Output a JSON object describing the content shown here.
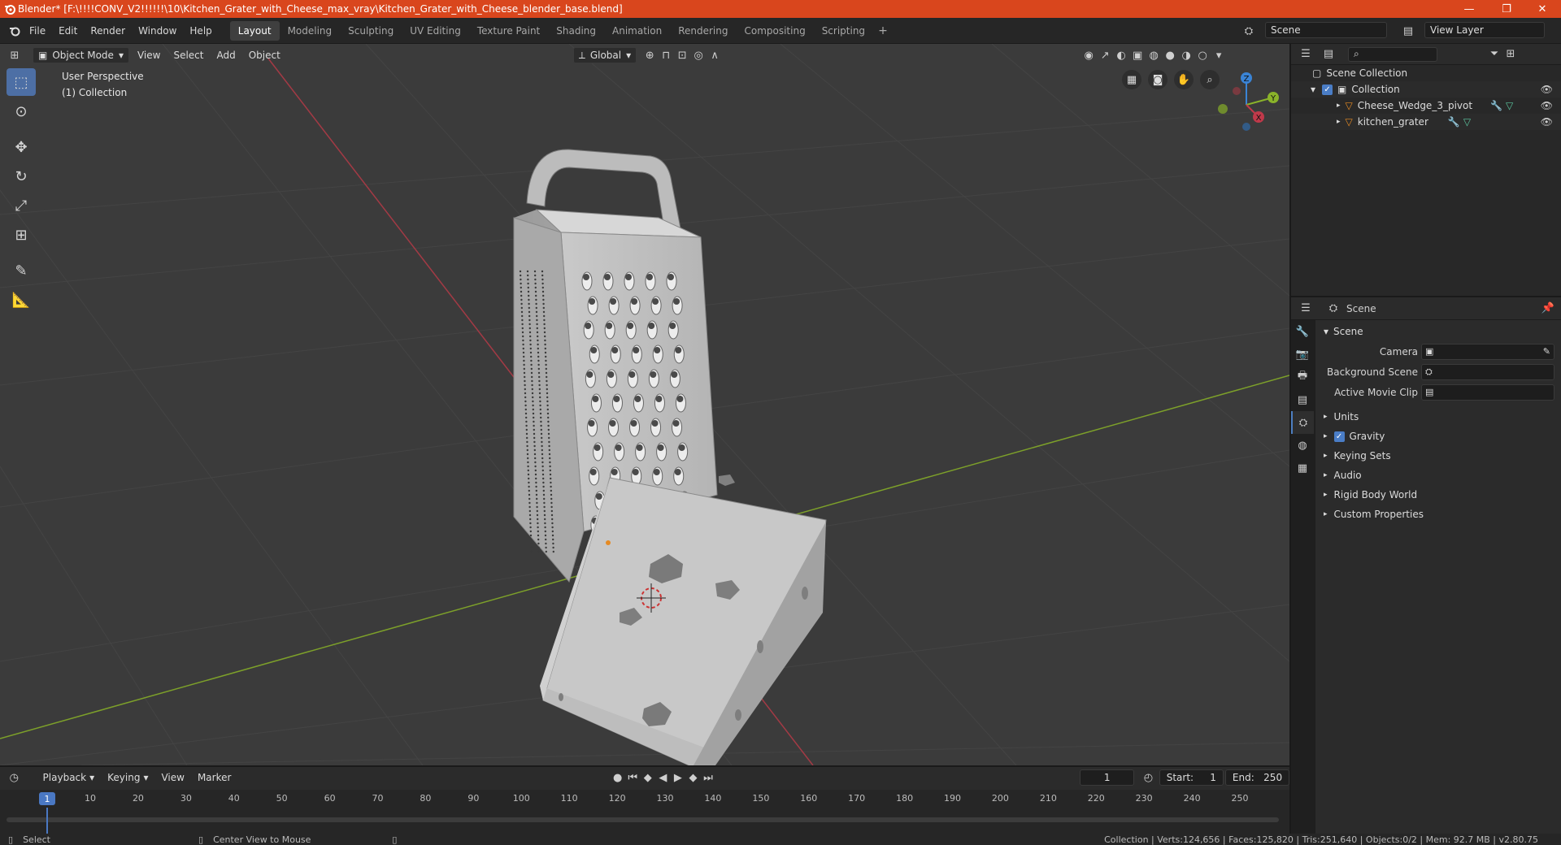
{
  "titlebar": {
    "title": "Blender* [F:\\!!!!CONV_V2!!!!!!\\10\\Kitchen_Grater_with_Cheese_max_vray\\Kitchen_Grater_with_Cheese_blender_base.blend]",
    "minimize": "—",
    "maximize": "❐",
    "close": "✕"
  },
  "menu": [
    "File",
    "Edit",
    "Render",
    "Window",
    "Help"
  ],
  "workspaces": [
    "Layout",
    "Modeling",
    "Sculpting",
    "UV Editing",
    "Texture Paint",
    "Shading",
    "Animation",
    "Rendering",
    "Compositing",
    "Scripting"
  ],
  "active_workspace": "Layout",
  "scene_field": "Scene",
  "view_layer_field": "View Layer",
  "viewport_header": {
    "mode": "Object Mode",
    "view": "View",
    "select": "Select",
    "add": "Add",
    "object": "Object",
    "orientation": "Global"
  },
  "viewport_info": {
    "line1": "User Perspective",
    "line2": "(1) Collection"
  },
  "gizmo": {
    "x": "X",
    "y": "Y",
    "z": "Z"
  },
  "outliner": {
    "root": "Scene Collection",
    "collection": "Collection",
    "items": [
      "Cheese_Wedge_3_pivot",
      "kitchen_grater"
    ]
  },
  "properties": {
    "header": "Scene",
    "panel": "Scene",
    "camera_label": "Camera",
    "background_label": "Background Scene",
    "movie_clip_label": "Active Movie Clip",
    "subpanels": [
      "Units",
      "Gravity",
      "Keying Sets",
      "Audio",
      "Rigid Body World",
      "Custom Properties"
    ]
  },
  "timeline": {
    "playback": "Playback",
    "keying": "Keying",
    "view": "View",
    "marker": "Marker",
    "current_frame": "1",
    "start_label": "Start:",
    "start": "1",
    "end_label": "End:",
    "end": "250",
    "ticks": [
      "1",
      "10",
      "20",
      "30",
      "40",
      "50",
      "60",
      "70",
      "80",
      "90",
      "100",
      "110",
      "120",
      "130",
      "140",
      "150",
      "160",
      "170",
      "180",
      "190",
      "200",
      "210",
      "220",
      "230",
      "240",
      "250"
    ]
  },
  "statusbar": {
    "select": "Select",
    "center_view": "Center View to Mouse",
    "stats": "Collection | Verts:124,656 | Faces:125,820 | Tris:251,640 | Objects:0/2 | Mem: 92.7 MB | v2.80.75"
  },
  "colors": {
    "titlebar": "#d9461d",
    "accent": "#4d7ec0",
    "x_axis": "#c0394a",
    "y_axis": "#8ab32a",
    "z_axis": "#3a84d6"
  }
}
